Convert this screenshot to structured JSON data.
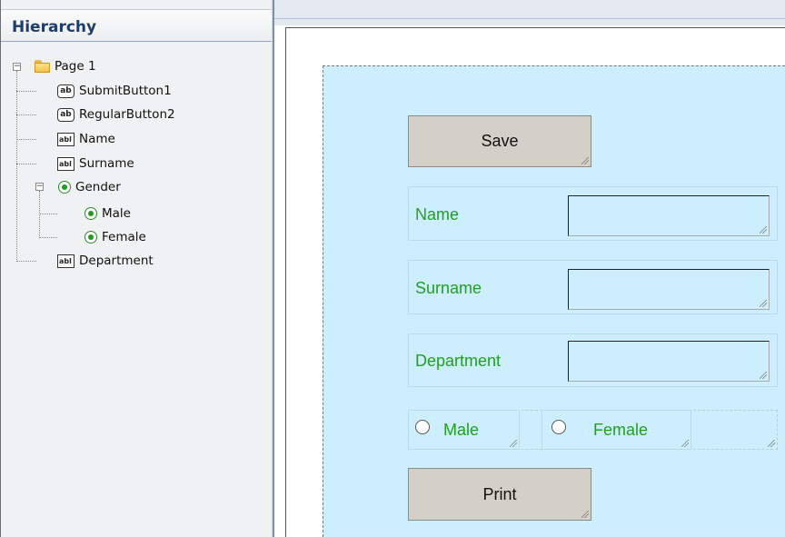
{
  "hierarchy": {
    "title": "Hierarchy",
    "root": {
      "label": "Page 1",
      "icon": "folder-icon"
    },
    "items": [
      {
        "label": "SubmitButton1",
        "icon": "button-icon",
        "icon_text": "ab"
      },
      {
        "label": "RegularButton2",
        "icon": "button-icon",
        "icon_text": "ab"
      },
      {
        "label": "Name",
        "icon": "textbox-icon",
        "icon_text": "abl"
      },
      {
        "label": "Surname",
        "icon": "textbox-icon",
        "icon_text": "abl"
      },
      {
        "label": "Gender",
        "icon": "radio-icon",
        "expanded": true,
        "children": [
          {
            "label": "Male",
            "icon": "radio-icon"
          },
          {
            "label": "Female",
            "icon": "radio-icon"
          }
        ]
      },
      {
        "label": "Department",
        "icon": "textbox-icon",
        "icon_text": "abl"
      }
    ]
  },
  "form": {
    "save_label": "Save",
    "print_label": "Print",
    "fields": [
      {
        "label": "Name",
        "value": ""
      },
      {
        "label": "Surname",
        "value": ""
      },
      {
        "label": "Department",
        "value": ""
      }
    ],
    "radios": [
      {
        "label": "Male",
        "checked": false
      },
      {
        "label": "Female",
        "checked": false
      }
    ]
  },
  "colors": {
    "form_background": "#cdeefc",
    "label_green": "#21a021",
    "button_gray": "#d4d0c8",
    "hierarchy_title": "#1e3c6e"
  }
}
